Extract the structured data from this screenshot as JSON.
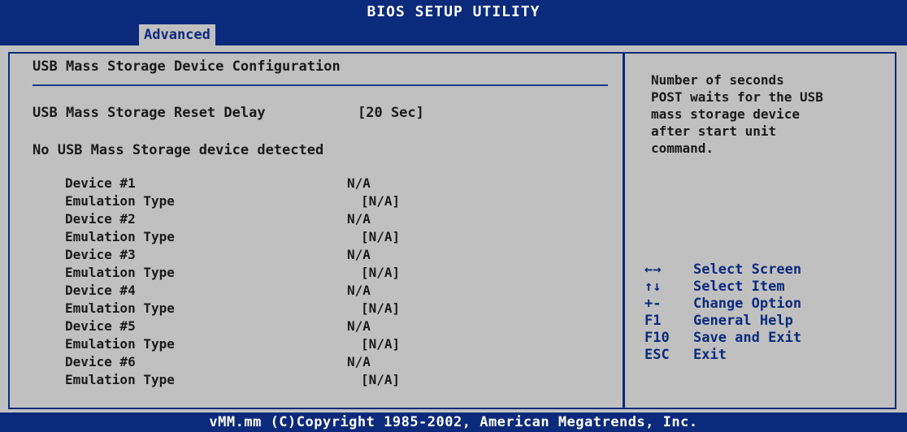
{
  "header": {
    "title": "BIOS SETUP UTILITY",
    "active_tab": "Advanced"
  },
  "main": {
    "section_title": "USB Mass Storage Device Configuration",
    "reset_delay": {
      "label": "USB Mass Storage Reset Delay",
      "value": "[20 Sec]"
    },
    "status_message": "No USB Mass Storage device detected",
    "devices": [
      {
        "device_label": "Device #1",
        "device_value": "N/A",
        "emulation_label": "Emulation Type",
        "emulation_value": "[N/A]"
      },
      {
        "device_label": "Device #2",
        "device_value": "N/A",
        "emulation_label": "Emulation Type",
        "emulation_value": "[N/A]"
      },
      {
        "device_label": "Device #3",
        "device_value": "N/A",
        "emulation_label": "Emulation Type",
        "emulation_value": "[N/A]"
      },
      {
        "device_label": "Device #4",
        "device_value": "N/A",
        "emulation_label": "Emulation Type",
        "emulation_value": "[N/A]"
      },
      {
        "device_label": "Device #5",
        "device_value": "N/A",
        "emulation_label": "Emulation Type",
        "emulation_value": "[N/A]"
      },
      {
        "device_label": "Device #6",
        "device_value": "N/A",
        "emulation_label": "Emulation Type",
        "emulation_value": "[N/A]"
      }
    ]
  },
  "help": {
    "text": "Number of seconds\nPOST waits for the USB\nmass storage device\nafter start unit\ncommand."
  },
  "legend": [
    {
      "key": "←→",
      "desc": "Select Screen"
    },
    {
      "key": "↑↓",
      "desc": "Select Item"
    },
    {
      "key": "+-",
      "desc": "Change Option"
    },
    {
      "key": "F1",
      "desc": "General Help"
    },
    {
      "key": "F10",
      "desc": "Save and Exit"
    },
    {
      "key": "ESC",
      "desc": "Exit"
    }
  ],
  "footer": {
    "copyright": "vMM.mm (C)Copyright 1985-2002, American Megatrends, Inc."
  },
  "colors": {
    "bios_blue": "#0b2a7c",
    "panel_gray": "#c0c0c0",
    "text_dark": "#1a1a1a",
    "text_white": "#ffffff"
  }
}
